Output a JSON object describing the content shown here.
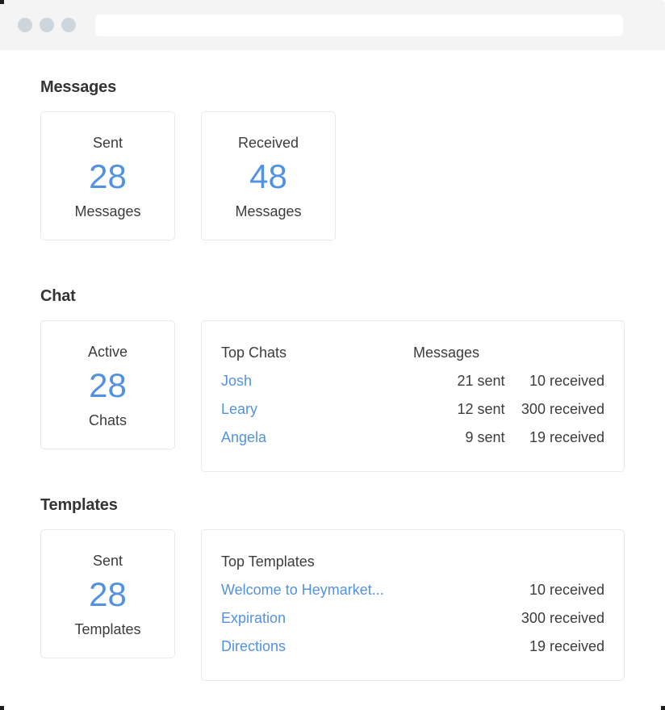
{
  "browser": {
    "dots": [
      "close-dot",
      "minimize-dot",
      "maximize-dot"
    ],
    "url_value": "",
    "url_placeholder": ""
  },
  "colors": {
    "accent_blue": "#5292e0",
    "text_dark": "#3c3c3c",
    "heading": "#343434",
    "card_border": "#e9e9ea",
    "chrome_bg": "#f4f4f5",
    "dot_gray": "#ced6dd"
  },
  "sections": [
    {
      "title": "Messages",
      "stats": [
        {
          "label": "Sent",
          "value": "28",
          "unit": "Messages"
        },
        {
          "label": "Received",
          "value": "48",
          "unit": "Messages"
        }
      ]
    },
    {
      "title": "Chat",
      "stats": [
        {
          "label": "Active",
          "value": "28",
          "unit": "Chats"
        }
      ],
      "list": {
        "headers": [
          "Top Chats",
          "Messages",
          ""
        ],
        "rows": [
          {
            "name": "Josh",
            "sent": "21 sent",
            "received": "10 received"
          },
          {
            "name": "Leary",
            "sent": "12 sent",
            "received": "300 received"
          },
          {
            "name": "Angela",
            "sent": "9 sent",
            "received": "19 received"
          }
        ]
      }
    },
    {
      "title": "Templates",
      "stats": [
        {
          "label": "Sent",
          "value": "28",
          "unit": "Templates"
        }
      ],
      "list": {
        "headers": [
          "Top Templates",
          "",
          ""
        ],
        "rows": [
          {
            "name": "Welcome to Heymarket...",
            "sent": "",
            "received": "10 received"
          },
          {
            "name": "Expiration",
            "sent": "",
            "received": "300 received"
          },
          {
            "name": "Directions",
            "sent": "",
            "received": "19 received"
          }
        ]
      }
    }
  ]
}
